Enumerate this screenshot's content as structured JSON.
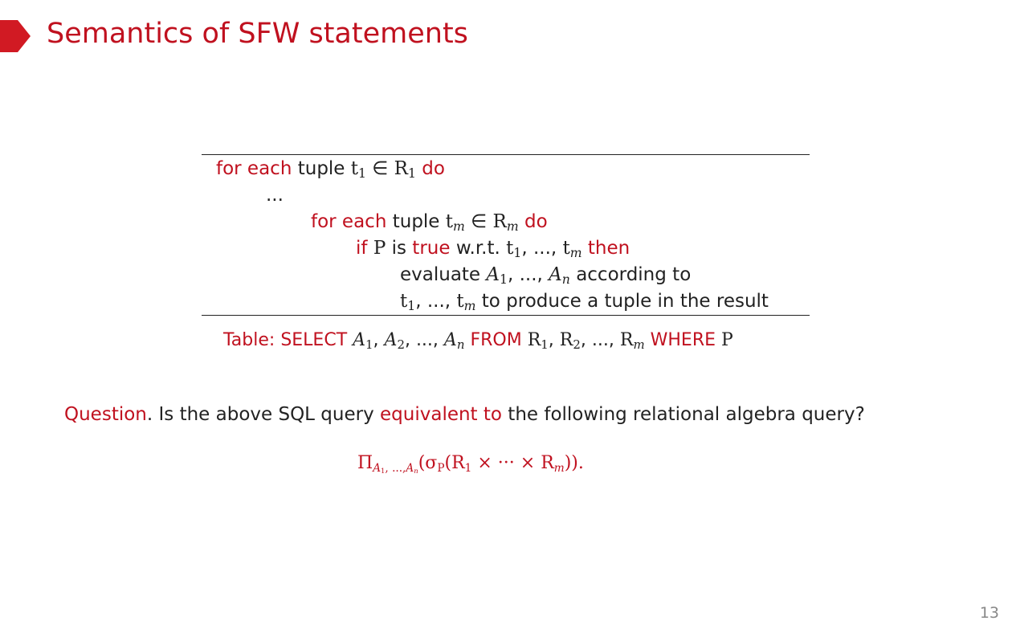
{
  "slide": {
    "title": "Semantics of SFW statements",
    "page_number": "13"
  },
  "algorithm": {
    "for_each": "for each",
    "tuple": "tuple",
    "do": "do",
    "ellipsis": "...",
    "if": "if",
    "is": "is",
    "true": "true",
    "wrt": "w.r.t.",
    "then": "then",
    "evaluate": "evaluate",
    "according_to": "according to",
    "to_produce": "to produce a tuple in the result",
    "sep_ellipsis": ", ...,",
    "comma": ",",
    "elem_of": "∈"
  },
  "caption": {
    "table": "Table:",
    "select": "SELECT",
    "from": "FROM",
    "where": "WHERE"
  },
  "question": {
    "label": "Question",
    "dot": ".",
    "text_before": " Is the above SQL query ",
    "highlight": "equivalent to",
    "text_after": " the following relational algebra query?"
  },
  "formula": {
    "pi": "Π",
    "sigma": "σ",
    "times": "×",
    "cdots": "···",
    "end": "))."
  },
  "symbols": {
    "t": "t",
    "R": "R",
    "A": "A",
    "P": "P",
    "one": "1",
    "two": "2",
    "m": "m",
    "n": "n"
  }
}
